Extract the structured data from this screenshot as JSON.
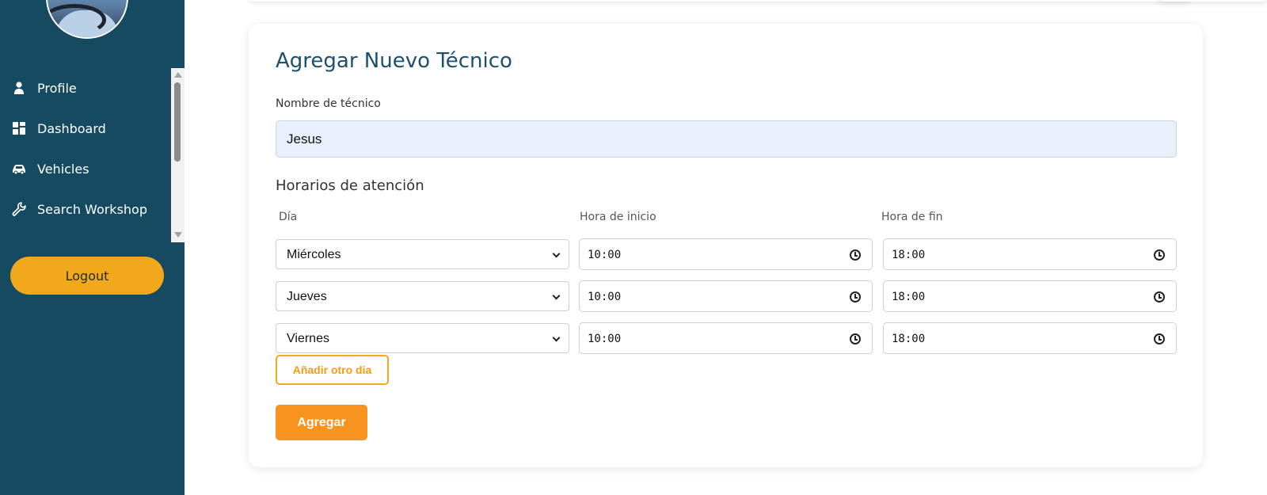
{
  "sidebar": {
    "items": [
      {
        "label": "Profile",
        "icon": "user-icon"
      },
      {
        "label": "Dashboard",
        "icon": "grid-icon"
      },
      {
        "label": "Vehicles",
        "icon": "car-icon"
      },
      {
        "label": "Search Workshop",
        "icon": "wrench-icon"
      }
    ],
    "logout_label": "Logout"
  },
  "form": {
    "title": "Agregar Nuevo Técnico",
    "name_label": "Nombre de técnico",
    "name_value": "Jesus",
    "schedule_title": "Horarios de atención",
    "columns": {
      "day": "Día",
      "start": "Hora de inicio",
      "end": "Hora de fin"
    },
    "rows": [
      {
        "day": "Miércoles",
        "start": "10:00",
        "end": "18:00"
      },
      {
        "day": "Jueves",
        "start": "10:00",
        "end": "18:00"
      },
      {
        "day": "Viernes",
        "start": "10:00",
        "end": "18:00"
      }
    ],
    "add_day_label": "Añadir otro dia",
    "submit_label": "Agregar"
  },
  "colors": {
    "sidebar_bg": "#164a60",
    "accent": "#f2a81d",
    "submit": "#f7931e",
    "title": "#1d4f6e",
    "input_fill": "#e8f0fe"
  }
}
